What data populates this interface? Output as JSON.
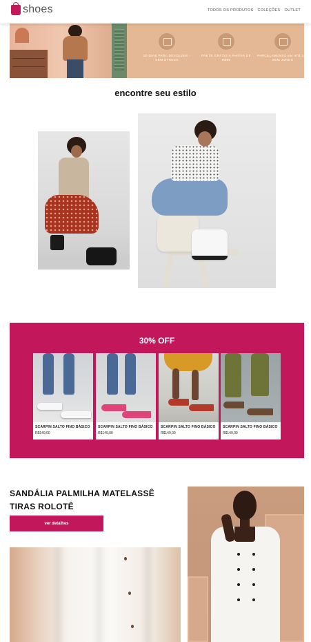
{
  "brand": {
    "logo_text": "shoes",
    "logo_icon": "shopping-bag-icon",
    "accent": "#c2185b"
  },
  "nav": {
    "items": [
      "TODOS OS PRODUTOS",
      "COLEÇÕES",
      "OUTLET"
    ]
  },
  "hero": {
    "features": [
      {
        "icon": "return-box-icon",
        "text": "30 DIAS PARA DEVOLVER - SEM STRESS"
      },
      {
        "icon": "truck-icon",
        "text": "FRETE GRÁTIS A PARTIR DE R$99"
      },
      {
        "icon": "card-icon",
        "text": "PARCELAMENTO EM ATÉ 10X SEM JUROS"
      }
    ]
  },
  "style_section": {
    "title": "encontre seu estilo"
  },
  "promo": {
    "title": "30% OFF",
    "background": "#c2185b",
    "products": [
      {
        "name": "SCARPIN SALTO FINO BÁSICO",
        "price": "R$149,00",
        "shoe_color": "#f7f7f7"
      },
      {
        "name": "SCARPIN SALTO FINO BÁSICO",
        "price": "R$149,00",
        "shoe_color": "#e0457a"
      },
      {
        "name": "SCARPIN SALTO FINO BÁSICO",
        "price": "R$149,00",
        "shoe_color": "#b3392a"
      },
      {
        "name": "SCARPIN SALTO FINO BÁSICO",
        "price": "R$149,00",
        "shoe_color": "#6b4a34"
      }
    ]
  },
  "feature_product": {
    "title": "SANDÁLIA PALMILHA MATELASSÊ TIRAS ROLOTÊ",
    "button_label": "ver detalhes"
  }
}
